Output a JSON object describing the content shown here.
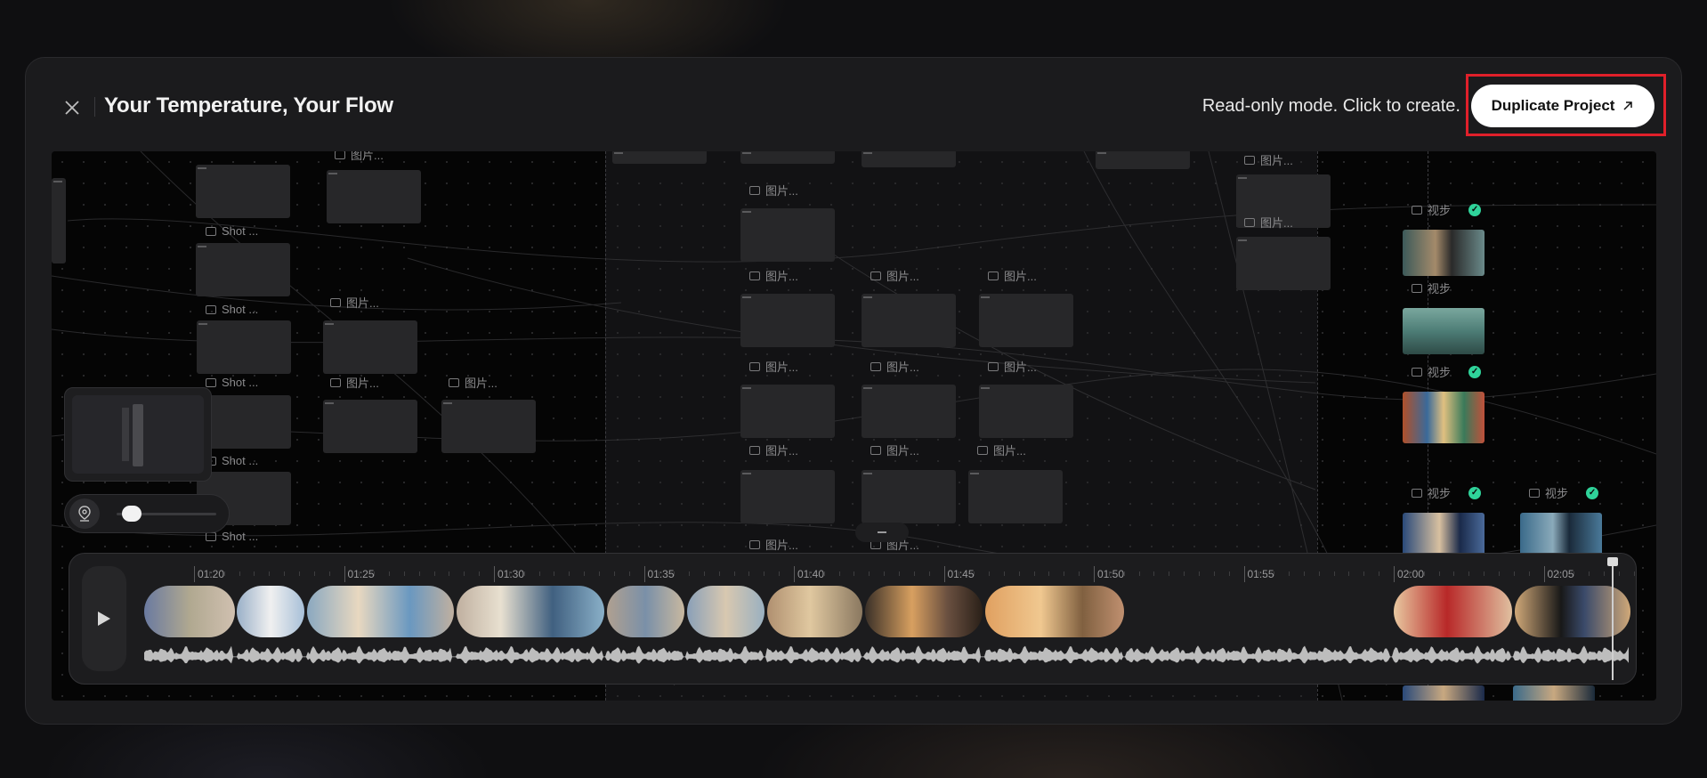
{
  "header": {
    "title": "Your Temperature, Your Flow",
    "readonly_text": "Read-only mode. Click to create.",
    "duplicate_label": "Duplicate Project"
  },
  "canvas": {
    "shot_label": "Shot ...",
    "image_label": "图片...",
    "video_label": "视步"
  },
  "timeline": {
    "ticks": [
      "01:20",
      "01:25",
      "01:30",
      "01:35",
      "01:40",
      "01:45",
      "01:50",
      "01:55",
      "02:00",
      "02:05"
    ]
  },
  "colors": {
    "accent_outline": "#e0202a",
    "check": "#2fd39a"
  },
  "icons": [
    "close-icon",
    "export-arrow-icon",
    "image-icon",
    "location-pin-icon",
    "play-icon",
    "check-icon"
  ]
}
